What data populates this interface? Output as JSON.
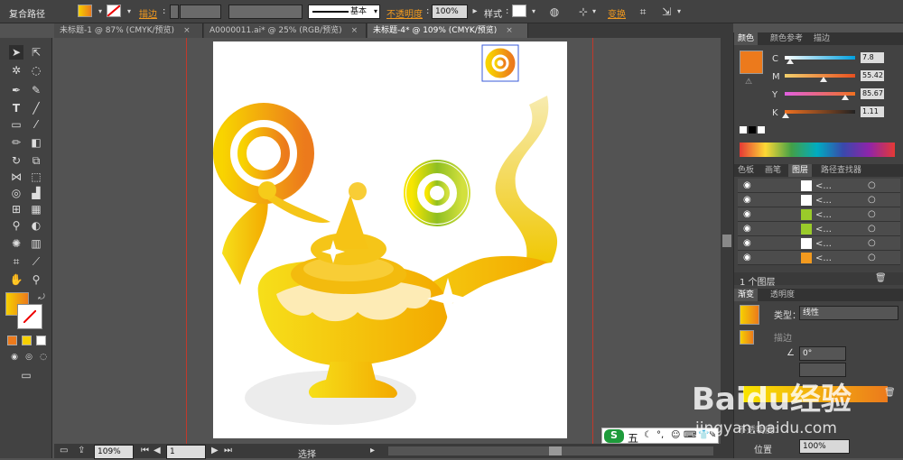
{
  "control_bar": {
    "object_type": "复合路径",
    "stroke_label": "描边",
    "stroke_profile": "基本",
    "opacity_label": "不透明度",
    "opacity_value": "100%",
    "style_label": "样式",
    "transform_label": "变换"
  },
  "tabs": [
    {
      "label": "未标题-1 @ 87% (CMYK/预览)",
      "close": "×"
    },
    {
      "label": "A0000011.ai* @ 25% (RGB/预览)",
      "close": "×"
    },
    {
      "label": "未标题-4* @ 109% (CMYK/预览)",
      "close": "×"
    }
  ],
  "color_panel": {
    "tabs": [
      "颜色",
      "颜色参考",
      "描边"
    ],
    "channels": [
      {
        "name": "C",
        "value": "7.8",
        "level": 0.078
      },
      {
        "name": "M",
        "value": "55.42",
        "level": 0.554
      },
      {
        "name": "Y",
        "value": "85.67",
        "level": 0.857
      },
      {
        "name": "K",
        "value": "1.11",
        "level": 0.011
      }
    ],
    "fill_color": "#ec7a1c"
  },
  "layers_panel": {
    "tabs": [
      "色板",
      "画笔",
      "图层",
      "路径查找器"
    ],
    "rows": [
      "<...",
      "<...",
      "<...",
      "<...",
      "<...",
      "<...",
      "<..."
    ],
    "footer": "1 个图层"
  },
  "gradient_panel": {
    "tabs": [
      "渐变",
      "透明度"
    ],
    "type_label": "类型：",
    "type_value": "线性",
    "stroke_label": "描边",
    "angle_value": "0°",
    "opacity_label": "不透明度：",
    "opacity_value": "100%",
    "position_label": "位置",
    "position_value": "100%"
  },
  "status_bar": {
    "zoom": "109%",
    "page": "1",
    "tool": "选择"
  },
  "ime": {
    "label": "五"
  },
  "watermark": {
    "brand": "Baidu经验",
    "url": "jingyan.baidu.com"
  },
  "colors": {
    "accent_orange": "#f39a1e",
    "gold": "#f5c000",
    "panel_bg": "#424242"
  }
}
